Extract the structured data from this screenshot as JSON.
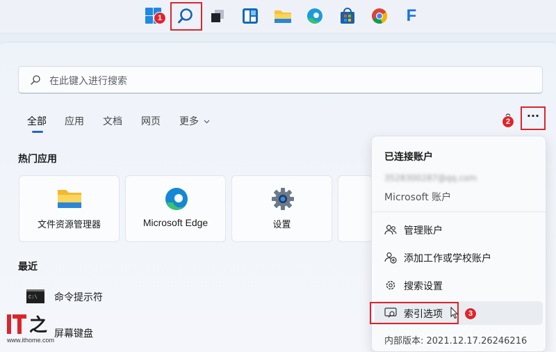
{
  "taskbar": {
    "icons": [
      "windows-start-icon",
      "search-icon",
      "task-view-icon",
      "widgets-icon",
      "file-explorer-icon",
      "edge-icon",
      "store-icon",
      "chrome-icon",
      "app-f-icon"
    ],
    "callout_1": "1"
  },
  "search": {
    "placeholder": "在此键入进行搜索"
  },
  "tabs": [
    {
      "label": "全部"
    },
    {
      "label": "应用"
    },
    {
      "label": "文档"
    },
    {
      "label": "网页"
    },
    {
      "label": "更多"
    }
  ],
  "callout_2": "2",
  "more_options": "···",
  "top_apps": {
    "title": "热门应用",
    "items": [
      {
        "label": "文件资源管理器"
      },
      {
        "label": "Microsoft Edge"
      },
      {
        "label": "设置"
      }
    ]
  },
  "recent": {
    "title": "最近",
    "items": [
      {
        "label": "命令提示符"
      },
      {
        "label": "屏幕键盘"
      }
    ]
  },
  "menu": {
    "header": "已连接账户",
    "email": "3528300287@qq.com",
    "account_type": "Microsoft 账户",
    "items": [
      {
        "label": "管理账户"
      },
      {
        "label": "添加工作或学校账户"
      },
      {
        "label": "搜索设置"
      },
      {
        "label": "索引选项"
      }
    ],
    "version": "内部版本: 2021.12.17.26246216",
    "callout_3": "3"
  },
  "watermark": {
    "text": "www.ithome.com"
  },
  "colors": {
    "accent": "#2a64c5",
    "callout_red": "#e0252b"
  }
}
